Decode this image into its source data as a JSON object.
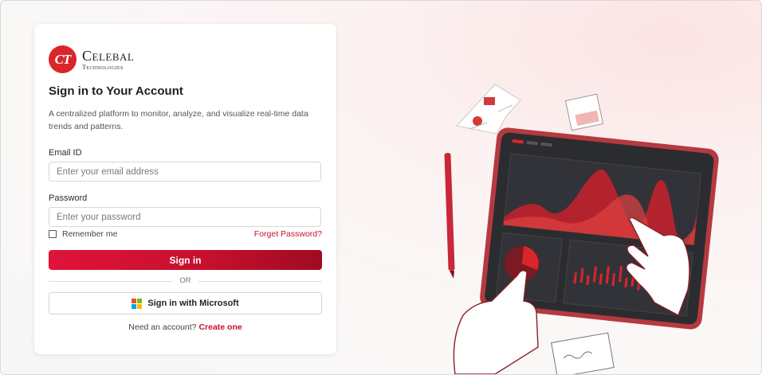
{
  "brand": {
    "mark": "CT",
    "name": "Celebal",
    "sub": "Technologies"
  },
  "form": {
    "title": "Sign in to Your Account",
    "description": "A centralized platform to monitor, analyze, and visualize real-time data trends and patterns.",
    "email_label": "Email ID",
    "email_placeholder": "Enter your email address",
    "password_label": "Password",
    "password_placeholder": "Enter your password",
    "remember_label": "Remember me",
    "forgot_label": "Forget Password?",
    "signin_label": "Sign in",
    "or_label": "OR",
    "microsoft_label": "Sign in with Microsoft",
    "need_account_text": "Need an account?",
    "create_label": "Create one"
  },
  "colors": {
    "accent": "#c8102e",
    "ms_red": "#f25022",
    "ms_green": "#7fba00",
    "ms_blue": "#00a4ef",
    "ms_yellow": "#ffb900"
  }
}
